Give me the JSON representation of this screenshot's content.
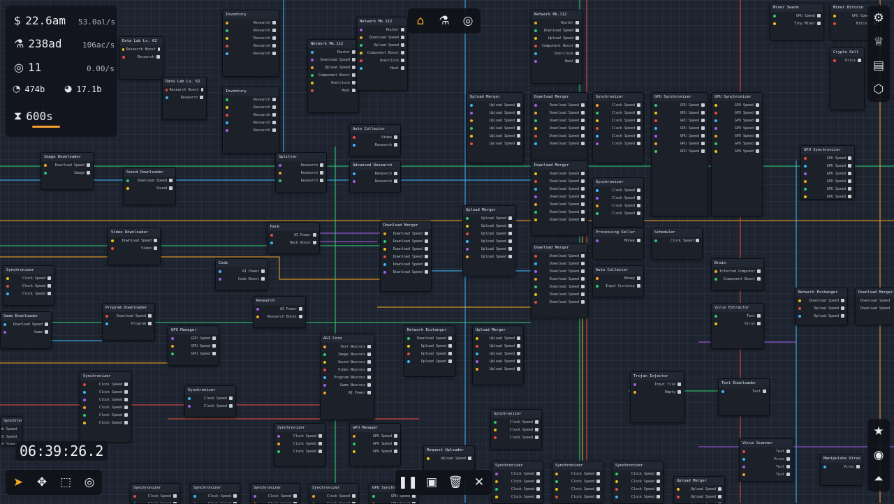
{
  "hud": {
    "money": "22.6am",
    "money_rate": "53.0al/s",
    "research": "238ad",
    "research_rate": "106ac/s",
    "processors": "11",
    "processor_rate": "0.00/s",
    "bandwidth": "474b",
    "clock": "17.1b",
    "timer": "600s"
  },
  "clock_readout": "06:39:26.2",
  "top_tabs": [
    {
      "name": "home-tab",
      "icon": "home-icon",
      "glyph": "⌂"
    },
    {
      "name": "research-tab",
      "icon": "flask-icon",
      "glyph": "⚗"
    },
    {
      "name": "processor-tab",
      "icon": "aperture-icon",
      "glyph": "◎"
    }
  ],
  "right_panel_top": [
    {
      "name": "settings-button",
      "icon": "gear-icon",
      "glyph": "⚙"
    },
    {
      "name": "achievements-button",
      "icon": "trophy-icon",
      "glyph": "♕"
    },
    {
      "name": "codex-button",
      "icon": "book-icon",
      "glyph": "▤"
    },
    {
      "name": "hex-button",
      "icon": "hexagon-icon",
      "glyph": "⬡"
    }
  ],
  "right_panel_bottom": [
    {
      "name": "favorites-button",
      "icon": "star-icon",
      "glyph": "★"
    },
    {
      "name": "target-button",
      "icon": "target-icon",
      "glyph": "◉"
    },
    {
      "name": "upgrade-button",
      "icon": "chevrons-up-icon",
      "glyph": "⏶"
    }
  ],
  "bottom_tools": [
    {
      "name": "select-tool",
      "icon": "cursor-icon",
      "glyph": "➤"
    },
    {
      "name": "move-tool",
      "icon": "move-icon",
      "glyph": "✥"
    },
    {
      "name": "box-select-tool",
      "icon": "box-select-icon",
      "glyph": "⬚"
    },
    {
      "name": "focus-tool",
      "icon": "circle-target-icon",
      "glyph": "◎"
    }
  ],
  "bottom_actions": [
    {
      "name": "pause-button",
      "icon": "pause-icon",
      "glyph": "❚❚"
    },
    {
      "name": "save-button",
      "icon": "floppy-icon",
      "glyph": "▣"
    },
    {
      "name": "delete-button",
      "icon": "trash-icon",
      "glyph": "🗑"
    },
    {
      "name": "close-button",
      "icon": "close-icon",
      "glyph": "✕"
    }
  ],
  "nodes": [
    {
      "title": "Inventory",
      "rows": [
        "Research",
        "Research",
        "Research",
        "Research",
        "Research"
      ]
    },
    {
      "title": "Inventory",
      "rows": [
        "Research",
        "Research",
        "Research",
        "Research",
        "Research"
      ]
    },
    {
      "title": "Data Lab Lv. 62",
      "rows": [
        "Research Boost",
        "Research"
      ]
    },
    {
      "title": "Data Lab Lv. 62",
      "rows": [
        "Research Boost",
        "Research"
      ]
    },
    {
      "title": "Network Mk.112",
      "rows": [
        "Router",
        "Download Speed",
        "Upload Speed",
        "Component Boost",
        "Overclock",
        "Heat"
      ]
    },
    {
      "title": "Network Mk.112",
      "rows": [
        "Router",
        "Download Speed",
        "Upload Speed",
        "Component Boost",
        "Overclock",
        "Heat"
      ]
    },
    {
      "title": "Network Mk.112",
      "rows": [
        "Router",
        "Download Speed",
        "Upload Speed",
        "Component Boost",
        "Overclock",
        "Heat"
      ]
    },
    {
      "title": "Miner Swarm",
      "rows": [
        "GPU Speed",
        "Tiny Miner"
      ]
    },
    {
      "title": "Miner Bitcoin",
      "rows": [
        "GPU Speed",
        "Bitcoin"
      ]
    },
    {
      "title": "Crypto Sell",
      "rows": [
        "Price"
      ]
    },
    {
      "title": "Upload Merger",
      "rows": [
        "Upload Speed",
        "Upload Speed",
        "Upload Speed",
        "Upload Speed",
        "Upload Speed",
        "Upload Speed"
      ]
    },
    {
      "title": "Download Merger",
      "rows": [
        "Download Speed",
        "Download Speed",
        "Download Speed",
        "Download Speed",
        "Download Speed",
        "Download Speed"
      ]
    },
    {
      "title": "Synchronizer",
      "rows": [
        "Clock Speed",
        "Clock Speed",
        "Clock Speed",
        "Clock Speed",
        "Clock Speed",
        "Clock Speed"
      ]
    },
    {
      "title": "GPU Synchronizer",
      "rows": [
        "GPU Speed",
        "GPU Speed",
        "GPU Speed",
        "GPU Speed",
        "GPU Speed",
        "GPU Speed",
        "GPU Speed"
      ]
    },
    {
      "title": "GPU Synchronizer",
      "rows": [
        "GPU Speed",
        "GPU Speed",
        "GPU Speed",
        "GPU Speed",
        "GPU Speed",
        "GPU Speed",
        "GPU Speed"
      ]
    },
    {
      "title": "Auto Collector",
      "rows": [
        "Video",
        "Research"
      ]
    },
    {
      "title": "Advanced Research",
      "rows": [
        "Research",
        "Research"
      ]
    },
    {
      "title": "Splitter",
      "rows": [
        "Research",
        "Research",
        "Research"
      ]
    },
    {
      "title": "Image Downloader",
      "rows": [
        "Download Speed",
        "Image"
      ]
    },
    {
      "title": "Sound Downloader",
      "rows": [
        "Download Speed",
        "Sound"
      ]
    },
    {
      "title": "Video Downloader",
      "rows": [
        "Download Speed",
        "Video"
      ]
    },
    {
      "title": "Hack",
      "rows": [
        "AI Power",
        "Hack Boost"
      ]
    },
    {
      "title": "Code",
      "rows": [
        "AI Power",
        "Code Boost"
      ]
    },
    {
      "title": "Research",
      "rows": [
        "AI Power",
        "Research Boost"
      ]
    },
    {
      "title": "Download Merger",
      "rows": [
        "Download Speed",
        "Download Speed",
        "Download Speed",
        "Download Speed",
        "Download Speed",
        "Download Speed"
      ]
    },
    {
      "title": "Upload Merger",
      "rows": [
        "Upload Speed",
        "Upload Speed",
        "Upload Speed",
        "Upload Speed",
        "Upload Speed",
        "Upload Speed"
      ]
    },
    {
      "title": "Download Merger",
      "rows": [
        "Download Speed",
        "Download Speed",
        "Download Speed",
        "Download Speed",
        "Download Speed",
        "Download Speed",
        "Download Speed"
      ]
    },
    {
      "title": "Download Merger",
      "rows": [
        "Download Speed",
        "Download Speed",
        "Download Speed",
        "Download Speed",
        "Download Speed",
        "Download Speed",
        "Download Speed"
      ]
    },
    {
      "title": "Synchronizer",
      "rows": [
        "Clock Speed",
        "Clock Speed",
        "Clock Speed",
        "Clock Speed"
      ]
    },
    {
      "title": "Processing Seller",
      "rows": [
        "Money"
      ]
    },
    {
      "title": "Auto Collector",
      "rows": [
        "Money",
        "Input Currency"
      ]
    },
    {
      "title": "Scheduler",
      "rows": [
        "Clock Speed"
      ]
    },
    {
      "title": "Synchronizer",
      "rows": [
        "Clock Speed",
        "Clock Speed",
        "Clock Speed"
      ]
    },
    {
      "title": "Program Downloader",
      "rows": [
        "Download Speed",
        "Program"
      ]
    },
    {
      "title": "Game Downloader",
      "rows": [
        "Download Speed",
        "Game"
      ]
    },
    {
      "title": "GPU Manager",
      "rows": [
        "GPU Speed",
        "GPU Speed",
        "GPU Speed"
      ]
    },
    {
      "title": "AGI Core",
      "rows": [
        "Text Neurons",
        "Image Neurons",
        "Sound Neurons",
        "Video Neurons",
        "Program Neurons",
        "Game Neurons",
        "AI Power"
      ]
    },
    {
      "title": "Network Exchanger",
      "rows": [
        "Download Speed",
        "Upload Speed",
        "Upload Speed",
        "Upload Speed"
      ]
    },
    {
      "title": "Upload Merger",
      "rows": [
        "Upload Speed",
        "Upload Speed",
        "Upload Speed",
        "Upload Speed",
        "Upload Speed"
      ]
    },
    {
      "title": "Synchronizer",
      "rows": [
        "Clock Speed",
        "Clock Speed",
        "Clock Speed",
        "Clock Speed",
        "Clock Speed",
        "Clock Speed"
      ]
    },
    {
      "title": "Synchronizer",
      "rows": [
        "Clock Speed",
        "Clock Speed"
      ]
    },
    {
      "title": "Trojan Injector",
      "rows": [
        "Input file",
        "Empty"
      ]
    },
    {
      "title": "Brain",
      "rows": [
        "Infected Computer",
        "Component Boost"
      ]
    },
    {
      "title": "Virus Extractor",
      "rows": [
        "Text",
        "Virus"
      ]
    },
    {
      "title": "Network Exchanger",
      "rows": [
        "Download Speed",
        "Upload Speed",
        "Upload Speed"
      ]
    },
    {
      "title": "Download Merger",
      "rows": [
        "Download Speed",
        "Download Speed"
      ]
    },
    {
      "title": "Text Downloader",
      "rows": [
        "Text"
      ]
    },
    {
      "title": "Synchronizer",
      "rows": [
        "Clock Speed",
        "Clock Speed",
        "Clock Speed"
      ]
    },
    {
      "title": "GPU Manager",
      "rows": [
        "GPU Speed",
        "GPU Speed",
        "GPU Speed"
      ]
    },
    {
      "title": "Synchronizer",
      "rows": [
        "Clock Speed",
        "Clock Speed",
        "Clock Speed"
      ]
    },
    {
      "title": "Request Uploader",
      "rows": [
        "Upload Speed"
      ]
    },
    {
      "title": "Virus Scanner",
      "rows": [
        "Text",
        "Virus",
        "Text",
        "Text"
      ]
    },
    {
      "title": "Manipulate Virus",
      "rows": [
        "Virus"
      ]
    },
    {
      "title": "Synchronizer",
      "rows": [
        "Clock Speed",
        "Clock Speed",
        "Clock Speed",
        "Clock Speed"
      ]
    },
    {
      "title": "Synchronizer",
      "rows": [
        "Clock Speed",
        "Clock Speed",
        "Clock Speed",
        "Clock Speed"
      ]
    },
    {
      "title": "Synchronizer",
      "rows": [
        "Clock Speed",
        "Clock Speed",
        "Clock Speed",
        "Clock Speed"
      ]
    },
    {
      "title": "Upload Merger",
      "rows": [
        "Upload Speed",
        "Upload Speed",
        "Upload Speed"
      ]
    },
    {
      "title": "Synchronizer",
      "rows": [
        "Clock Speed",
        "Clock Speed"
      ]
    },
    {
      "title": "Synchronizer",
      "rows": [
        "Clock Speed",
        "Clock Speed"
      ]
    },
    {
      "title": "Synchronizer",
      "rows": [
        "Clock Speed",
        "Clock Speed"
      ]
    },
    {
      "title": "Synchronizer",
      "rows": [
        "Clock Speed",
        "Clock Speed"
      ]
    },
    {
      "title": "GPU Synchronizer",
      "rows": [
        "GPU Speed",
        "GPU Speed"
      ]
    },
    {
      "title": "Synchronizer",
      "rows": [
        "Clock Speed",
        "Clock Speed",
        "Clock Speed"
      ]
    },
    {
      "title": "GPU Synchronizer",
      "rows": [
        "GPU Speed",
        "GPU Speed",
        "GPU Speed",
        "GPU Speed",
        "GPU Speed",
        "GPU Speed"
      ]
    }
  ]
}
